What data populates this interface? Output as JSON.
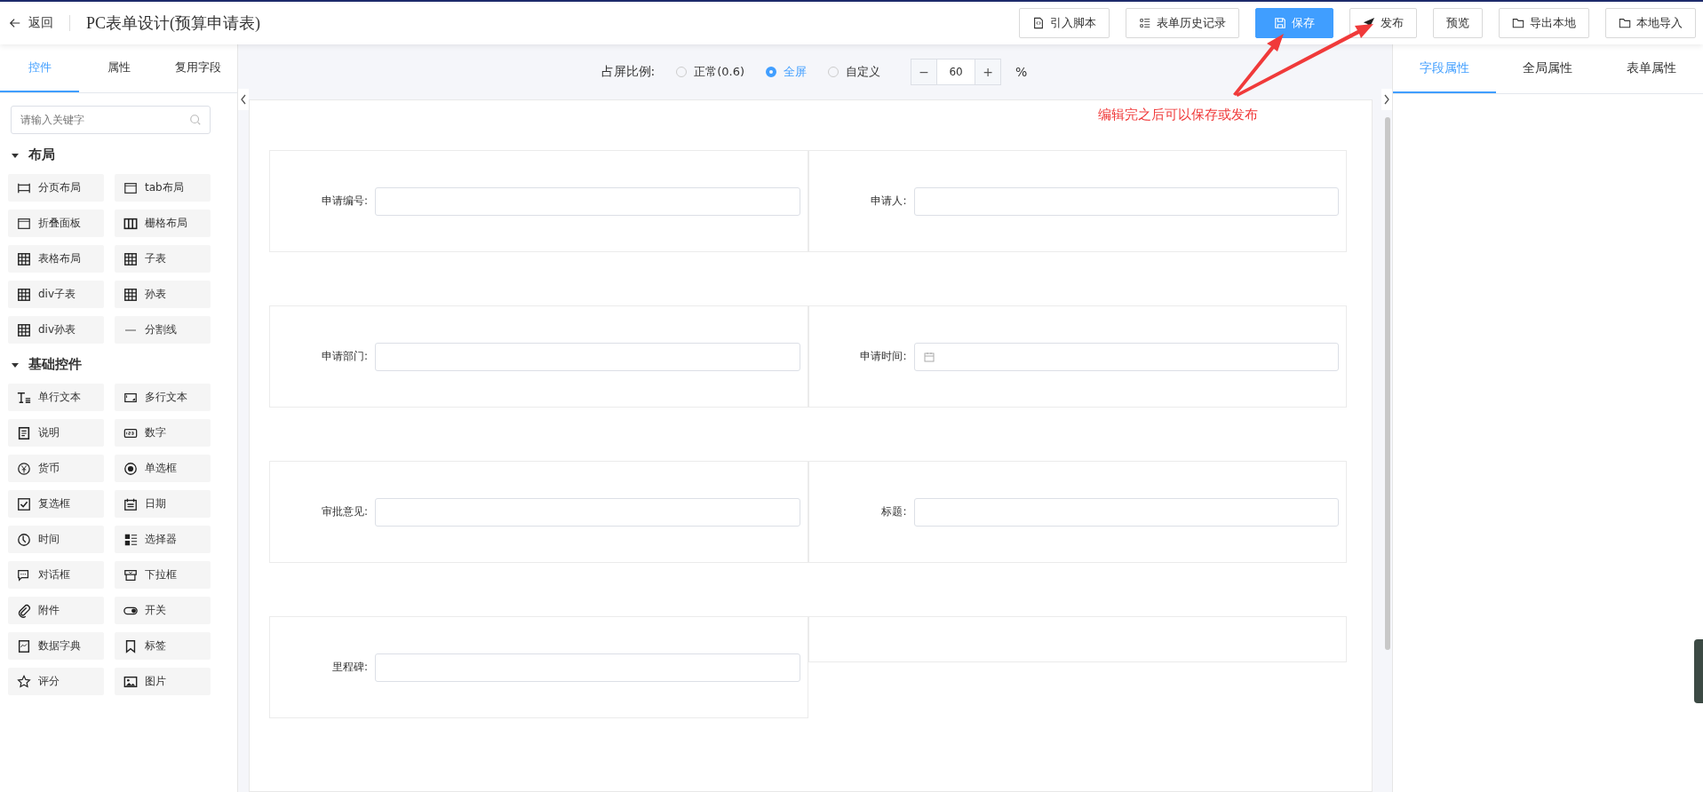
{
  "header": {
    "back": "返回",
    "title": "PC表单设计(预算申请表)",
    "buttons": [
      {
        "label": "引入脚本",
        "primary": false
      },
      {
        "label": "表单历史记录",
        "primary": false
      },
      {
        "label": "保存",
        "primary": true
      },
      {
        "label": "发布",
        "primary": false
      },
      {
        "label": "预览",
        "primary": false
      },
      {
        "label": "导出本地",
        "primary": false
      },
      {
        "label": "本地导入",
        "primary": false
      }
    ]
  },
  "left_panel": {
    "tabs": [
      {
        "label": "控件",
        "selected": true
      },
      {
        "label": "属性",
        "selected": false
      },
      {
        "label": "复用字段",
        "selected": false
      }
    ],
    "search": {
      "placeholder": "请输入关键字"
    },
    "groups": [
      {
        "title": "布局",
        "expanded": true,
        "items": [
          "分页布局",
          "tab布局",
          "折叠面板",
          "栅格布局",
          "表格布局",
          "子表",
          "div子表",
          "孙表",
          "div孙表",
          "分割线"
        ]
      },
      {
        "title": "基础控件",
        "expanded": true,
        "items": [
          "单行文本",
          "多行文本",
          "说明",
          "数字",
          "货币",
          "单选框",
          "复选框",
          "日期",
          "时间",
          "选择器",
          "对话框",
          "下拉框",
          "附件",
          "开关",
          "数据字典",
          "标签",
          "评分",
          "图片"
        ]
      }
    ]
  },
  "canvas": {
    "ratio_label": "占屏比例:",
    "ratio_options": [
      {
        "label": "正常(0.6)",
        "selected": false
      },
      {
        "label": "全屏",
        "selected": true
      },
      {
        "label": "自定义",
        "selected": false
      }
    ],
    "zoom": {
      "minus": "−",
      "value": "60",
      "plus": "+",
      "unit": "%"
    },
    "rows": [
      {
        "fields": [
          {
            "kind": "text",
            "label": "申请编号:"
          },
          {
            "kind": "text",
            "label": "申请人:"
          }
        ]
      },
      {
        "fields": [
          {
            "kind": "text",
            "label": "申请部门:"
          },
          {
            "kind": "date",
            "label": "申请时间:"
          }
        ]
      },
      {
        "fields": [
          {
            "kind": "text",
            "label": "审批意见:"
          },
          {
            "kind": "text",
            "label": "标题:"
          }
        ]
      },
      {
        "fields": [
          {
            "kind": "text",
            "label": "里程碑:"
          },
          {
            "kind": "empty"
          }
        ]
      }
    ]
  },
  "annotation": {
    "text": "编辑完之后可以保存或发布"
  },
  "right_panel": {
    "tabs": [
      {
        "label": "字段属性",
        "selected": true
      },
      {
        "label": "全局属性",
        "selected": false
      },
      {
        "label": "表单属性",
        "selected": false
      }
    ]
  }
}
